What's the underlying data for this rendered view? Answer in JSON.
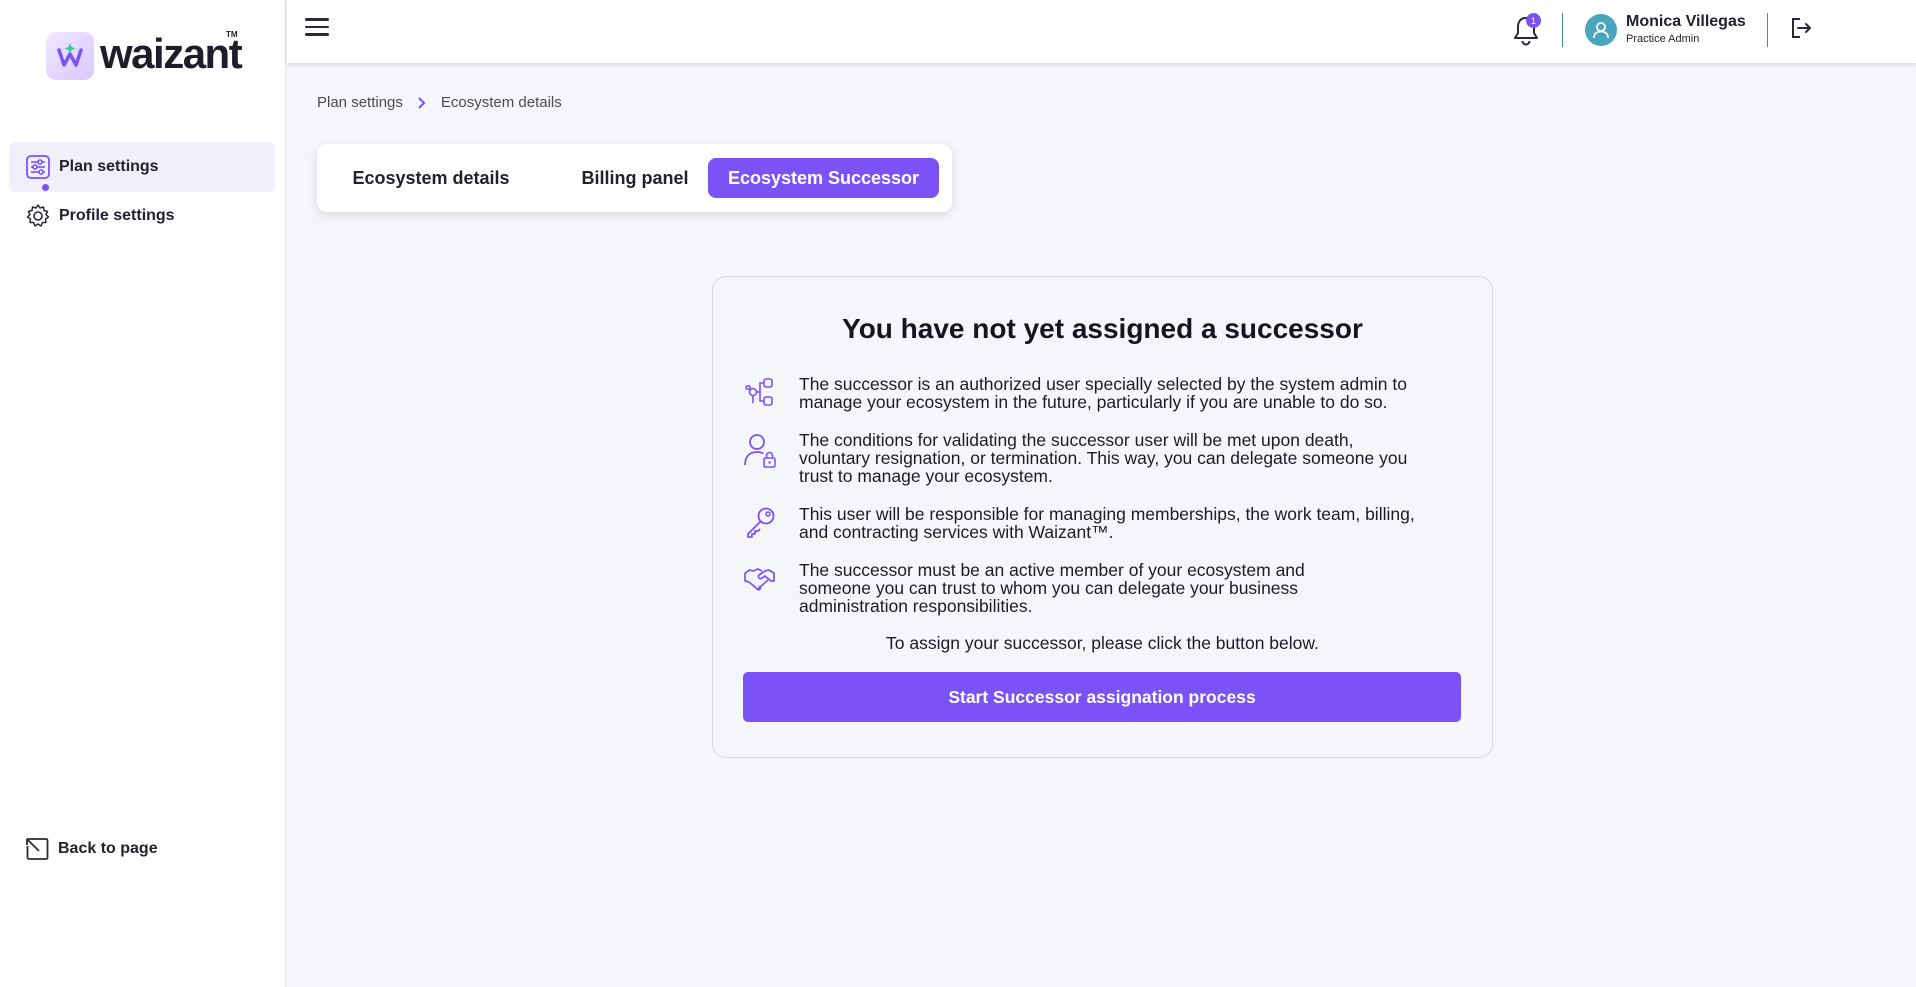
{
  "brand": {
    "name": "waizant",
    "tm": "TM"
  },
  "sidebar": {
    "items": [
      {
        "label": "Plan settings",
        "icon": "sliders-icon",
        "active": true
      },
      {
        "label": "Profile settings",
        "icon": "gear-icon",
        "active": false
      }
    ],
    "back_label": "Back to page"
  },
  "topbar": {
    "notifications_count": "1",
    "user_name": "Monica Villegas",
    "user_role": "Practice Admin"
  },
  "breadcrumb": [
    "Plan settings",
    "Ecosystem details"
  ],
  "tabs": [
    {
      "label": "Ecosystem details",
      "active": false
    },
    {
      "label": "Billing panel",
      "active": false
    },
    {
      "label": "Ecosystem Successor",
      "active": true
    }
  ],
  "card": {
    "title": "You have not yet assigned a successor",
    "points": [
      {
        "icon": "network-icon",
        "lines": [
          "The successor is an authorized user specially selected by the system admin to",
          "manage your ecosystem in the future, particularly if you are unable to do so."
        ]
      },
      {
        "icon": "user-lock-icon",
        "lines": [
          "The conditions for validating the successor user will be met upon death,",
          "voluntary resignation, or termination. This way, you can delegate someone you",
          "trust to manage your ecosystem."
        ]
      },
      {
        "icon": "key-icon",
        "lines": [
          "This user will be responsible for managing memberships, the work team, billing,",
          "and contracting services with Waizant™."
        ]
      },
      {
        "icon": "handshake-icon",
        "lines": [
          "The successor must be an active member of your ecosystem and",
          "someone you can trust to whom you can delegate your business",
          "administration responsibilities."
        ]
      }
    ],
    "assign_note": "To assign your successor, please click the button below.",
    "cta_label": "Start Successor assignation process"
  },
  "colors": {
    "accent": "#7b52f5",
    "avatar": "#4aa5bf",
    "background": "#f4f6fa"
  }
}
